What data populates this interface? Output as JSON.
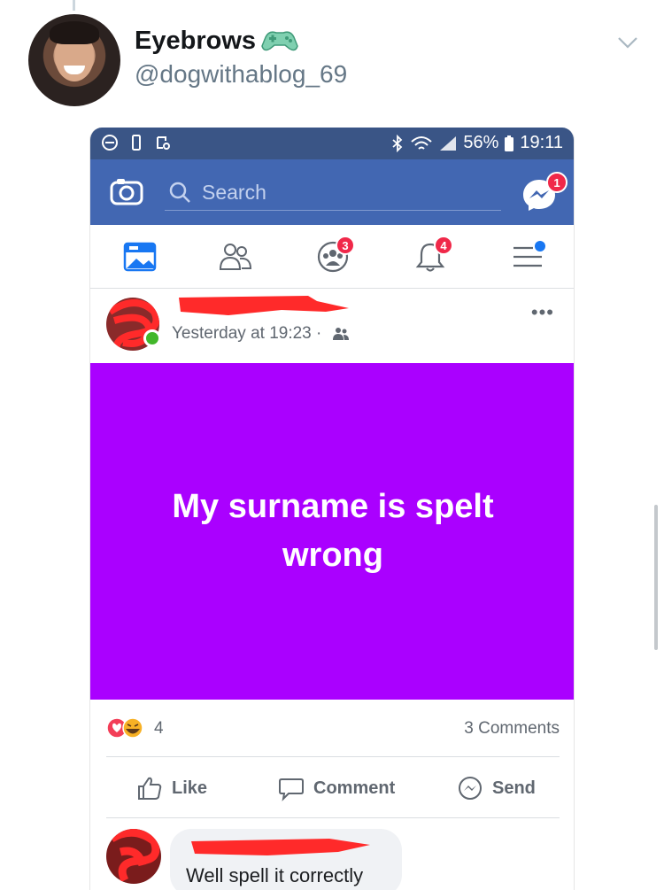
{
  "tweet": {
    "display_name": "Eyebrows",
    "handle": "@dogwithablog_69",
    "name_emoji": "green-game-controller-emoji"
  },
  "screenshot": {
    "status_bar": {
      "battery": "56%",
      "time": "19:11"
    },
    "facebook_bar": {
      "search_placeholder": "Search",
      "messenger_badge": "1"
    },
    "nav": {
      "groups_badge": "3",
      "notifications_badge": "4"
    },
    "post": {
      "timestamp": "Yesterday at 19:23 ·",
      "more": "•••",
      "text": "My surname is spelt wrong",
      "background_color": "#aa00ff",
      "reaction_count": "4",
      "comments_count": "3 Comments",
      "actions": {
        "like": "Like",
        "comment": "Comment",
        "send": "Send"
      }
    },
    "comment": {
      "text": "Well spell it correctly"
    }
  },
  "colors": {
    "facebook_blue": "#4267b2",
    "status_bar": "#3a5586",
    "badge_red": "#f02849",
    "online_green": "#42b72a"
  }
}
